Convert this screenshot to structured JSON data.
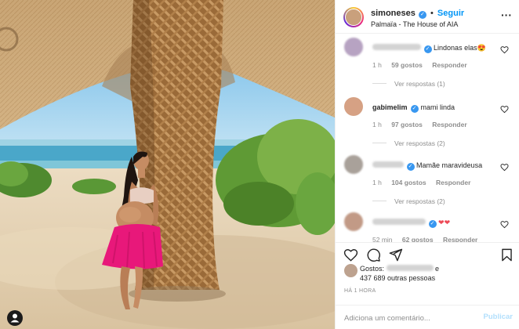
{
  "post": {
    "author": "simoneses",
    "follow_label": "Seguir",
    "location": "Palmaïa - The House of AIA",
    "more_icon": "more-horizontal-icon"
  },
  "comments": [
    {
      "user": "",
      "text": "Lindonas elas😍",
      "time": "1 h",
      "likes": "59 gostos",
      "reply": "Responder",
      "view_replies": "Ver respostas (1)"
    },
    {
      "user": "gabimelim",
      "text": "mami linda",
      "time": "1 h",
      "likes": "97 gostos",
      "reply": "Responder",
      "view_replies": "Ver respostas (2)"
    },
    {
      "user": "",
      "text": "Mamãe maravideusa",
      "time": "1 h",
      "likes": "104 gostos",
      "reply": "Responder",
      "view_replies": "Ver respostas (2)"
    },
    {
      "user": "",
      "text": "❤❤",
      "time": "52 min",
      "likes": "62 gostos",
      "reply": "Responder"
    }
  ],
  "likes": {
    "prefix": "Gostos:",
    "conjunction": "e",
    "others": "437 689 outras pessoas"
  },
  "timestamp": "HÁ 1 HORA",
  "add_comment": {
    "placeholder": "Adiciona um comentário...",
    "publish_label": "Publicar"
  },
  "colors": {
    "accent": "#0095f6",
    "verified": "#3897f0",
    "publish_disabled": "#b2dffc",
    "skirt": "#e8187a"
  }
}
